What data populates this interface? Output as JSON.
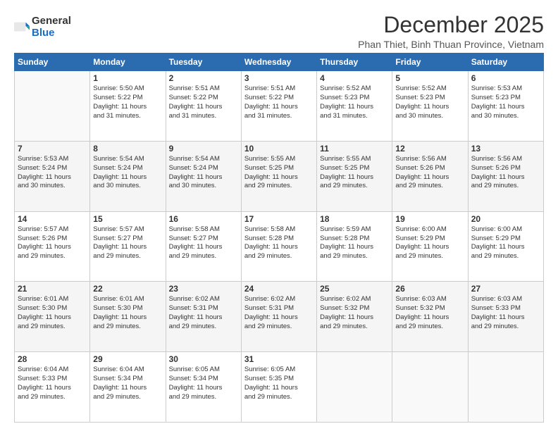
{
  "logo": {
    "general": "General",
    "blue": "Blue"
  },
  "title": "December 2025",
  "subtitle": "Phan Thiet, Binh Thuan Province, Vietnam",
  "weekdays": [
    "Sunday",
    "Monday",
    "Tuesday",
    "Wednesday",
    "Thursday",
    "Friday",
    "Saturday"
  ],
  "weeks": [
    [
      {
        "day": "",
        "info": ""
      },
      {
        "day": "1",
        "info": "Sunrise: 5:50 AM\nSunset: 5:22 PM\nDaylight: 11 hours\nand 31 minutes."
      },
      {
        "day": "2",
        "info": "Sunrise: 5:51 AM\nSunset: 5:22 PM\nDaylight: 11 hours\nand 31 minutes."
      },
      {
        "day": "3",
        "info": "Sunrise: 5:51 AM\nSunset: 5:22 PM\nDaylight: 11 hours\nand 31 minutes."
      },
      {
        "day": "4",
        "info": "Sunrise: 5:52 AM\nSunset: 5:23 PM\nDaylight: 11 hours\nand 31 minutes."
      },
      {
        "day": "5",
        "info": "Sunrise: 5:52 AM\nSunset: 5:23 PM\nDaylight: 11 hours\nand 30 minutes."
      },
      {
        "day": "6",
        "info": "Sunrise: 5:53 AM\nSunset: 5:23 PM\nDaylight: 11 hours\nand 30 minutes."
      }
    ],
    [
      {
        "day": "7",
        "info": "Sunrise: 5:53 AM\nSunset: 5:24 PM\nDaylight: 11 hours\nand 30 minutes."
      },
      {
        "day": "8",
        "info": "Sunrise: 5:54 AM\nSunset: 5:24 PM\nDaylight: 11 hours\nand 30 minutes."
      },
      {
        "day": "9",
        "info": "Sunrise: 5:54 AM\nSunset: 5:24 PM\nDaylight: 11 hours\nand 30 minutes."
      },
      {
        "day": "10",
        "info": "Sunrise: 5:55 AM\nSunset: 5:25 PM\nDaylight: 11 hours\nand 29 minutes."
      },
      {
        "day": "11",
        "info": "Sunrise: 5:55 AM\nSunset: 5:25 PM\nDaylight: 11 hours\nand 29 minutes."
      },
      {
        "day": "12",
        "info": "Sunrise: 5:56 AM\nSunset: 5:26 PM\nDaylight: 11 hours\nand 29 minutes."
      },
      {
        "day": "13",
        "info": "Sunrise: 5:56 AM\nSunset: 5:26 PM\nDaylight: 11 hours\nand 29 minutes."
      }
    ],
    [
      {
        "day": "14",
        "info": "Sunrise: 5:57 AM\nSunset: 5:26 PM\nDaylight: 11 hours\nand 29 minutes."
      },
      {
        "day": "15",
        "info": "Sunrise: 5:57 AM\nSunset: 5:27 PM\nDaylight: 11 hours\nand 29 minutes."
      },
      {
        "day": "16",
        "info": "Sunrise: 5:58 AM\nSunset: 5:27 PM\nDaylight: 11 hours\nand 29 minutes."
      },
      {
        "day": "17",
        "info": "Sunrise: 5:58 AM\nSunset: 5:28 PM\nDaylight: 11 hours\nand 29 minutes."
      },
      {
        "day": "18",
        "info": "Sunrise: 5:59 AM\nSunset: 5:28 PM\nDaylight: 11 hours\nand 29 minutes."
      },
      {
        "day": "19",
        "info": "Sunrise: 6:00 AM\nSunset: 5:29 PM\nDaylight: 11 hours\nand 29 minutes."
      },
      {
        "day": "20",
        "info": "Sunrise: 6:00 AM\nSunset: 5:29 PM\nDaylight: 11 hours\nand 29 minutes."
      }
    ],
    [
      {
        "day": "21",
        "info": "Sunrise: 6:01 AM\nSunset: 5:30 PM\nDaylight: 11 hours\nand 29 minutes."
      },
      {
        "day": "22",
        "info": "Sunrise: 6:01 AM\nSunset: 5:30 PM\nDaylight: 11 hours\nand 29 minutes."
      },
      {
        "day": "23",
        "info": "Sunrise: 6:02 AM\nSunset: 5:31 PM\nDaylight: 11 hours\nand 29 minutes."
      },
      {
        "day": "24",
        "info": "Sunrise: 6:02 AM\nSunset: 5:31 PM\nDaylight: 11 hours\nand 29 minutes."
      },
      {
        "day": "25",
        "info": "Sunrise: 6:02 AM\nSunset: 5:32 PM\nDaylight: 11 hours\nand 29 minutes."
      },
      {
        "day": "26",
        "info": "Sunrise: 6:03 AM\nSunset: 5:32 PM\nDaylight: 11 hours\nand 29 minutes."
      },
      {
        "day": "27",
        "info": "Sunrise: 6:03 AM\nSunset: 5:33 PM\nDaylight: 11 hours\nand 29 minutes."
      }
    ],
    [
      {
        "day": "28",
        "info": "Sunrise: 6:04 AM\nSunset: 5:33 PM\nDaylight: 11 hours\nand 29 minutes."
      },
      {
        "day": "29",
        "info": "Sunrise: 6:04 AM\nSunset: 5:34 PM\nDaylight: 11 hours\nand 29 minutes."
      },
      {
        "day": "30",
        "info": "Sunrise: 6:05 AM\nSunset: 5:34 PM\nDaylight: 11 hours\nand 29 minutes."
      },
      {
        "day": "31",
        "info": "Sunrise: 6:05 AM\nSunset: 5:35 PM\nDaylight: 11 hours\nand 29 minutes."
      },
      {
        "day": "",
        "info": ""
      },
      {
        "day": "",
        "info": ""
      },
      {
        "day": "",
        "info": ""
      }
    ]
  ]
}
